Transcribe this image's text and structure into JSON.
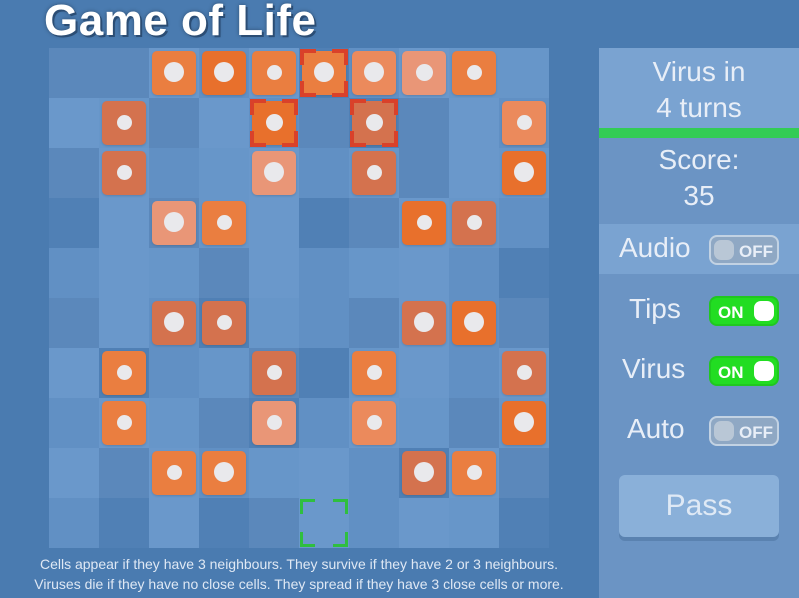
{
  "title": "Game of Life",
  "board": {
    "size": 10,
    "tile_colors": [
      "#5b88bb",
      "#6a98cb",
      "#6190c4",
      "#5080b5",
      "#6796c9"
    ],
    "tiles": [
      [
        0,
        0,
        1,
        2,
        1,
        3,
        2,
        1,
        4,
        4
      ],
      [
        1,
        4,
        0,
        1,
        2,
        0,
        3,
        0,
        1,
        2
      ],
      [
        0,
        1,
        2,
        4,
        1,
        2,
        4,
        0,
        1,
        4
      ],
      [
        3,
        1,
        0,
        4,
        1,
        3,
        0,
        1,
        4,
        2
      ],
      [
        2,
        1,
        4,
        0,
        1,
        2,
        4,
        1,
        2,
        3
      ],
      [
        0,
        1,
        2,
        3,
        4,
        2,
        0,
        1,
        2,
        0
      ],
      [
        1,
        3,
        2,
        4,
        0,
        3,
        4,
        1,
        2,
        1
      ],
      [
        2,
        1,
        4,
        0,
        3,
        2,
        1,
        4,
        0,
        4
      ],
      [
        1,
        0,
        1,
        2,
        4,
        1,
        2,
        3,
        1,
        0
      ],
      [
        2,
        3,
        1,
        3,
        0,
        1,
        2,
        1,
        4,
        3
      ]
    ],
    "piece_colors": {
      "dark": "#e8702c",
      "mid": "#ea7e40",
      "light": "#eb8a5c",
      "pale": "#e99677",
      "dusky": "#d4724e"
    },
    "pieces": [
      {
        "r": 0,
        "c": 2,
        "shade": "mid",
        "dot": "large"
      },
      {
        "r": 0,
        "c": 3,
        "shade": "dark",
        "dot": "large"
      },
      {
        "r": 0,
        "c": 4,
        "shade": "mid",
        "dot": "small"
      },
      {
        "r": 0,
        "c": 5,
        "shade": "mid",
        "dot": "large",
        "virus": true
      },
      {
        "r": 0,
        "c": 6,
        "shade": "light",
        "dot": "large"
      },
      {
        "r": 0,
        "c": 7,
        "shade": "pale",
        "dot": "mid"
      },
      {
        "r": 0,
        "c": 8,
        "shade": "mid",
        "dot": "small"
      },
      {
        "r": 1,
        "c": 1,
        "shade": "dusky",
        "dot": "small"
      },
      {
        "r": 1,
        "c": 4,
        "shade": "dark",
        "dot": "mid",
        "virus": true
      },
      {
        "r": 1,
        "c": 6,
        "shade": "dusky",
        "dot": "mid",
        "virus": true
      },
      {
        "r": 1,
        "c": 9,
        "shade": "light",
        "dot": "small"
      },
      {
        "r": 2,
        "c": 1,
        "shade": "dusky",
        "dot": "small"
      },
      {
        "r": 2,
        "c": 4,
        "shade": "pale",
        "dot": "large"
      },
      {
        "r": 2,
        "c": 6,
        "shade": "dusky",
        "dot": "small"
      },
      {
        "r": 2,
        "c": 9,
        "shade": "dark",
        "dot": "large"
      },
      {
        "r": 3,
        "c": 2,
        "shade": "pale",
        "dot": "large"
      },
      {
        "r": 3,
        "c": 3,
        "shade": "mid",
        "dot": "small"
      },
      {
        "r": 3,
        "c": 7,
        "shade": "dark",
        "dot": "small"
      },
      {
        "r": 3,
        "c": 8,
        "shade": "dusky",
        "dot": "small"
      },
      {
        "r": 5,
        "c": 2,
        "shade": "dusky",
        "dot": "large"
      },
      {
        "r": 5,
        "c": 3,
        "shade": "dusky",
        "dot": "small"
      },
      {
        "r": 5,
        "c": 7,
        "shade": "dusky",
        "dot": "large"
      },
      {
        "r": 5,
        "c": 8,
        "shade": "dark",
        "dot": "large"
      },
      {
        "r": 6,
        "c": 1,
        "shade": "mid",
        "dot": "small"
      },
      {
        "r": 6,
        "c": 4,
        "shade": "dusky",
        "dot": "small"
      },
      {
        "r": 6,
        "c": 6,
        "shade": "mid",
        "dot": "small"
      },
      {
        "r": 6,
        "c": 9,
        "shade": "dusky",
        "dot": "small"
      },
      {
        "r": 7,
        "c": 1,
        "shade": "mid",
        "dot": "small"
      },
      {
        "r": 7,
        "c": 4,
        "shade": "pale",
        "dot": "small"
      },
      {
        "r": 7,
        "c": 6,
        "shade": "light",
        "dot": "small"
      },
      {
        "r": 7,
        "c": 9,
        "shade": "dark",
        "dot": "large"
      },
      {
        "r": 8,
        "c": 2,
        "shade": "mid",
        "dot": "small"
      },
      {
        "r": 8,
        "c": 3,
        "shade": "mid",
        "dot": "large"
      },
      {
        "r": 8,
        "c": 7,
        "shade": "dusky",
        "dot": "large"
      },
      {
        "r": 8,
        "c": 8,
        "shade": "mid",
        "dot": "small"
      }
    ],
    "cursor": {
      "r": 9,
      "c": 5,
      "color": "#2fbf3f"
    },
    "virus_marker_color": "#d9412a"
  },
  "help": {
    "line1": "Cells appear if they have 3 neighbours. They survive if they have 2 or 3 neighbours.",
    "line2": "Viruses die if they have no close cells. They spread if they have 3 close cells or more."
  },
  "panel": {
    "virus_line1": "Virus in",
    "virus_line2": "4 turns",
    "score_label": "Score:",
    "score_value": "35",
    "audio": {
      "label": "Audio",
      "state": "OFF"
    },
    "tips": {
      "label": "Tips",
      "state": "ON"
    },
    "virus": {
      "label": "Virus",
      "state": "ON"
    },
    "auto": {
      "label": "Auto",
      "state": "OFF"
    },
    "pass_label": "Pass"
  },
  "colors": {
    "background": "#4a7bb0",
    "panel": "#6b94c4",
    "virus_bar": "#33cc55",
    "toggle_on": "#22dd22"
  }
}
